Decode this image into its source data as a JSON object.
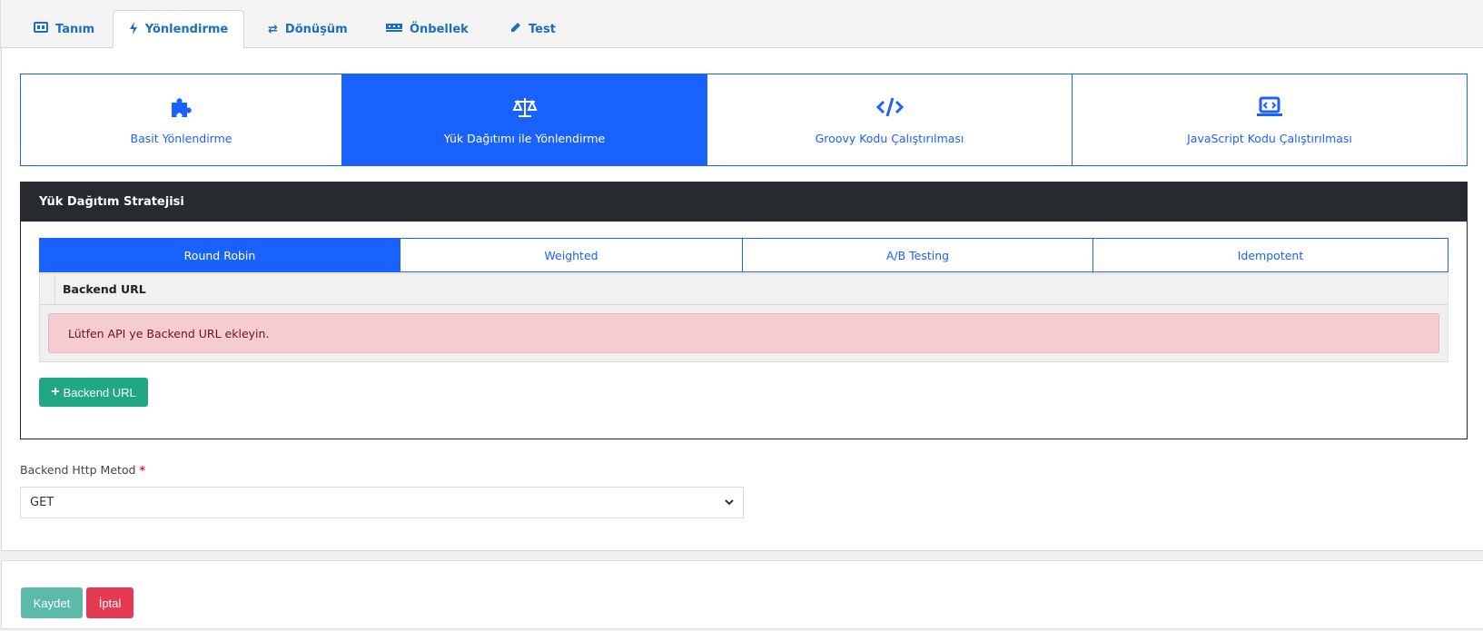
{
  "tabs": [
    {
      "label": "Tanım",
      "icon": "id-card-icon"
    },
    {
      "label": "Yönlendirme",
      "icon": "bolt-icon",
      "active": true
    },
    {
      "label": "Dönüşüm",
      "icon": "exchange-icon"
    },
    {
      "label": "Önbellek",
      "icon": "memory-icon"
    },
    {
      "label": "Test",
      "icon": "eyedropper-icon"
    }
  ],
  "routing_types": [
    {
      "label": "Basit Yönlendirme",
      "icon": "puzzle-icon"
    },
    {
      "label": "Yük Dağıtımı ile Yönlendirme",
      "icon": "balance-scale-icon",
      "active": true
    },
    {
      "label": "Groovy Kodu Çalıştırılması",
      "icon": "code-icon"
    },
    {
      "label": "JavaScript Kodu Çalıştırılması",
      "icon": "laptop-code-icon"
    }
  ],
  "strategy": {
    "title": "Yük Dağıtım Stratejisi",
    "tabs": [
      "Round Robin",
      "Weighted",
      "A/B Testing",
      "Idempotent"
    ],
    "active_tab": "Round Robin",
    "table_header": "Backend URL",
    "alert": "Lütfen API ye Backend URL ekleyin.",
    "add_button": "Backend URL"
  },
  "method": {
    "label": "Backend Http Metod",
    "required": "*",
    "value": "GET"
  },
  "footer": {
    "save": "Kaydet",
    "cancel": "İptal"
  },
  "colors": {
    "primary": "#1a62ff",
    "success": "#20a884",
    "save": "#5cbba6",
    "cancel": "#e63a52",
    "alert_bg": "#f5ccd2",
    "panel_head": "#272a2f"
  }
}
